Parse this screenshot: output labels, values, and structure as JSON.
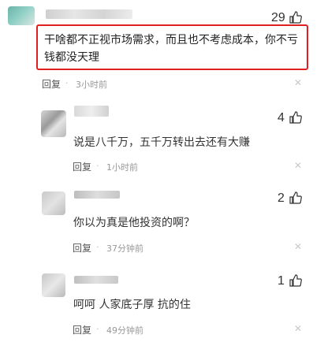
{
  "comments": [
    {
      "likes": "29",
      "text": "干啥都不正视市场需求，而且也不考虑成本，你不亏钱都没天理",
      "reply": "回复",
      "time": "3小时前"
    },
    {
      "likes": "4",
      "text": "说是八千万，五千万转出去还有大赚",
      "reply": "回复",
      "time": "1小时前"
    },
    {
      "likes": "2",
      "text": "你以为真是他投资的啊？",
      "reply": "回复",
      "time": "37分钟前"
    },
    {
      "likes": "1",
      "text": "呵呵 人家底子厚 抗的住",
      "reply": "回复",
      "time": "49分钟前"
    }
  ],
  "separator": "·",
  "icons": {
    "like": "thumbs-up-icon",
    "close": "close-icon"
  },
  "colors": {
    "highlight_border": "#e02020",
    "time_text": "#999999"
  }
}
